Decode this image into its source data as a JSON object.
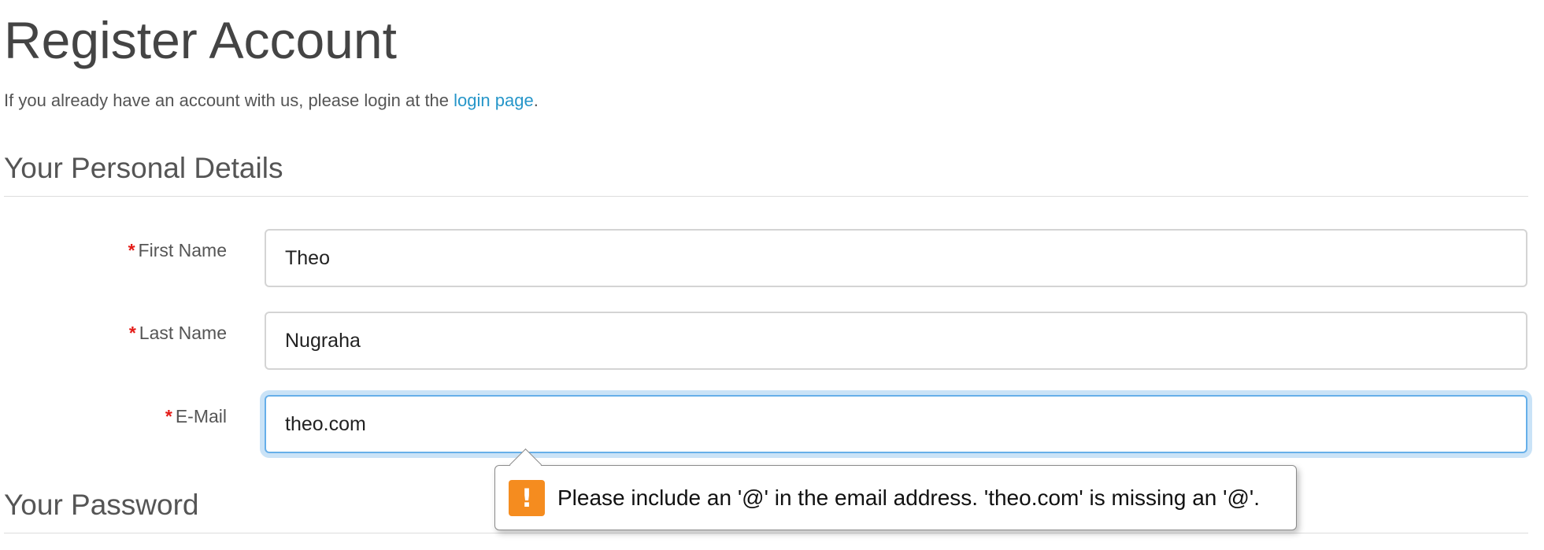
{
  "page": {
    "title": "Register Account",
    "intro_before_link": "If you already have an account with us, please login at the ",
    "intro_link": "login page",
    "intro_after_link": "."
  },
  "sections": {
    "personal_details": "Your Personal Details",
    "password": "Your Password"
  },
  "fields": {
    "required_marker": "*",
    "first_name": {
      "label": "First Name",
      "value": "Theo"
    },
    "last_name": {
      "label": "Last Name",
      "value": "Nugraha"
    },
    "email": {
      "label": "E-Mail",
      "value": "theo.com",
      "focused": true
    }
  },
  "validation_tooltip": {
    "icon": "warning-exclamation-icon",
    "icon_glyph": "!",
    "message": "Please include an '@' in the email address. 'theo.com' is missing an '@'."
  },
  "colors": {
    "link": "#2696c9",
    "required_star": "#e41b17",
    "focus_ring": "#66afe9",
    "warning_icon_bg": "#f58c1f"
  }
}
